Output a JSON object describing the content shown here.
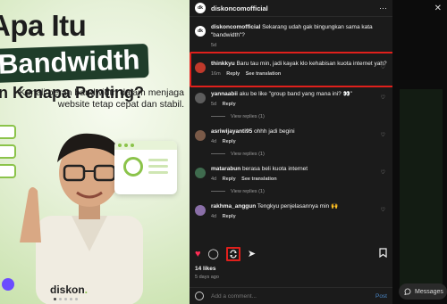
{
  "image": {
    "headline_line1": "Apa Itu",
    "headline_line2": "Bandwidth",
    "headline_line3": "an Kenapa Penting?",
    "lead": "Kenali peran bandwidth dalam menjaga website tetap cepat dan stabil.",
    "brand": "diskon"
  },
  "post": {
    "username": "diskoncomofficial",
    "avatar_text": "dk",
    "caption": "Sekarang udah gak bingungkan sama kata \"bandwidth\"?",
    "caption_time": "5d"
  },
  "comments": [
    {
      "user": "thinkkyu",
      "text": "Baru tau min, jadi kayak klo kehabisan kuota internet yah?",
      "time": "16m",
      "reply": "Reply",
      "translate": "See translation",
      "replies": ""
    },
    {
      "user": "yannaabii",
      "text": "aku be like \"group band yang mana ini? 👀\"",
      "time": "5d",
      "reply": "Reply",
      "translate": "",
      "replies": "View replies (1)"
    },
    {
      "user": "asriwijayanti95",
      "text": "ohhh jadi begini",
      "time": "4d",
      "reply": "Reply",
      "translate": "",
      "replies": "View replies (1)"
    },
    {
      "user": "matarabun",
      "text": "berasa beli kuota internet",
      "time": "4d",
      "reply": "Reply",
      "translate": "See translation",
      "replies": "View replies (1)"
    },
    {
      "user": "rakhma_anggun",
      "text": "Tengkyu penjelasannya min 🙌",
      "time": "4d",
      "reply": "Reply",
      "translate": "",
      "replies": ""
    }
  ],
  "footer": {
    "likes": "14 likes",
    "ago": "5 days ago",
    "comment_placeholder": "Add a comment...",
    "post_label": "Post"
  },
  "right_strip": {
    "messages_label": "Messages"
  },
  "colors": {
    "highlight": "#e0201c",
    "like": "#ff2d55"
  }
}
